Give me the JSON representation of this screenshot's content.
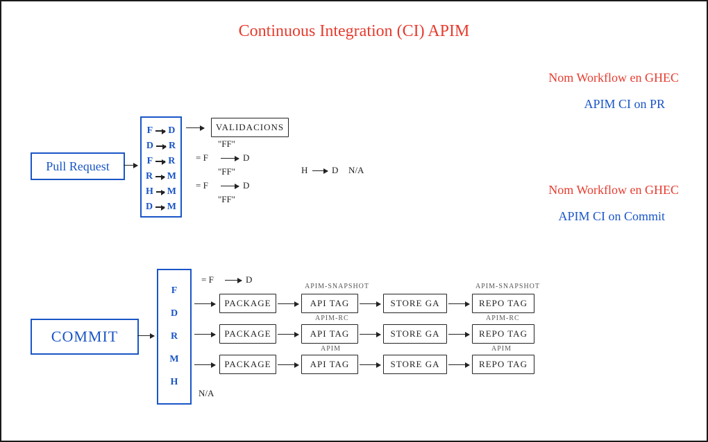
{
  "title": "Continuous Integration (CI) APIM",
  "side": {
    "pr": {
      "label": "Nom Workflow en GHEC",
      "value": "APIM CI on PR"
    },
    "commit": {
      "label": "Nom Workflow en GHEC",
      "value": "APIM CI on Commit"
    }
  },
  "pr": {
    "box": "Pull Request",
    "transitions": [
      {
        "from": "F",
        "to": "D"
      },
      {
        "from": "D",
        "to": "R"
      },
      {
        "from": "F",
        "to": "R"
      },
      {
        "from": "R",
        "to": "M"
      },
      {
        "from": "H",
        "to": "M"
      },
      {
        "from": "D",
        "to": "M"
      }
    ],
    "validations_box": "VALIDACIONS",
    "notes": {
      "ff1": "\"FF\"",
      "eqFD1": "=  F",
      "arrowD1": "D",
      "ff2": "\"FF\"",
      "eqFD2": "=  F",
      "arrowD2": "D",
      "ff3": "\"FF\"",
      "HtoD": "H",
      "HtoD_D": "D",
      "na": "N/A"
    }
  },
  "commit": {
    "box": "COMMIT",
    "letters": [
      "F",
      "D",
      "R",
      "M",
      "H"
    ],
    "eqFD": "=  F",
    "arrowD": "D",
    "na": "N/A",
    "rows": [
      {
        "tag_caption": "APIM-SNAPSHOT",
        "repo_caption": "APIM-SNAPSHOT"
      },
      {
        "tag_caption": "APIM-RC",
        "repo_caption": "APIM-RC"
      },
      {
        "tag_caption": "APIM",
        "repo_caption": "APIM"
      }
    ],
    "labels": {
      "package": "PACKAGE",
      "apitag": "API TAG",
      "store": "STORE GA",
      "repotag": "REPO TAG"
    }
  }
}
